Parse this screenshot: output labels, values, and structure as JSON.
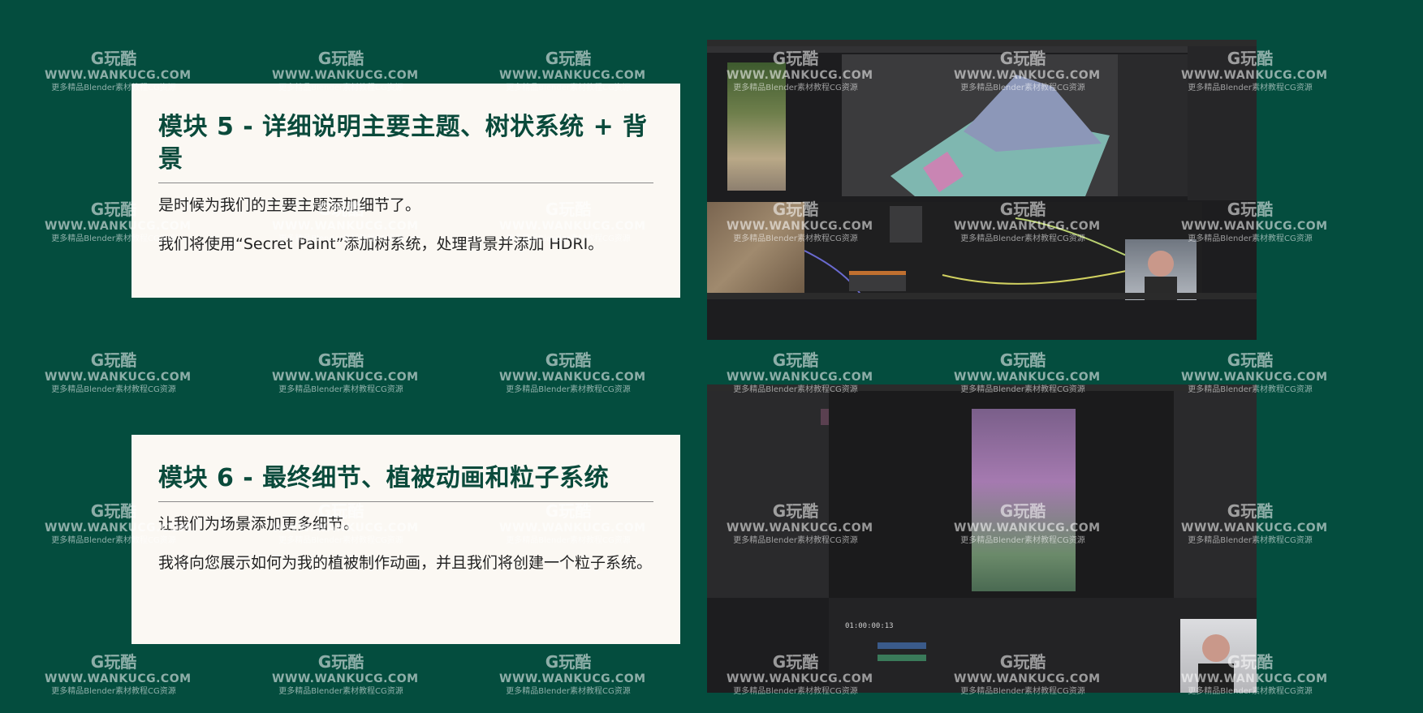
{
  "modules": [
    {
      "title": "模块 5 - 详细说明主要主题、树状系统 + 背景",
      "paragraphs": [
        "是时候为我们的主要主题添加细节了。",
        "我们将使用“Secret Paint”添加树系统，处理背景并添加 HDRI。"
      ]
    },
    {
      "title": "模块 6 - 最终细节、植被动画和粒子系统",
      "paragraphs": [
        "让我们为场景添加更多细节。",
        "我将向您展示如何为我的植被制作动画，并且我们将创建一个粒子系统。"
      ]
    }
  ],
  "screenshots": [
    {
      "app": "blender-editor"
    },
    {
      "app": "video-editor",
      "timecode": "01:00:00:13"
    }
  ],
  "watermark": {
    "logo": "G玩酷",
    "site": "WWW.WANKUCG.COM",
    "tagline": "更多精品Blender素材教程CG资源"
  },
  "colors": {
    "background": "#044d3e",
    "card": "#fbf8f3",
    "heading": "#0a4a3b"
  }
}
